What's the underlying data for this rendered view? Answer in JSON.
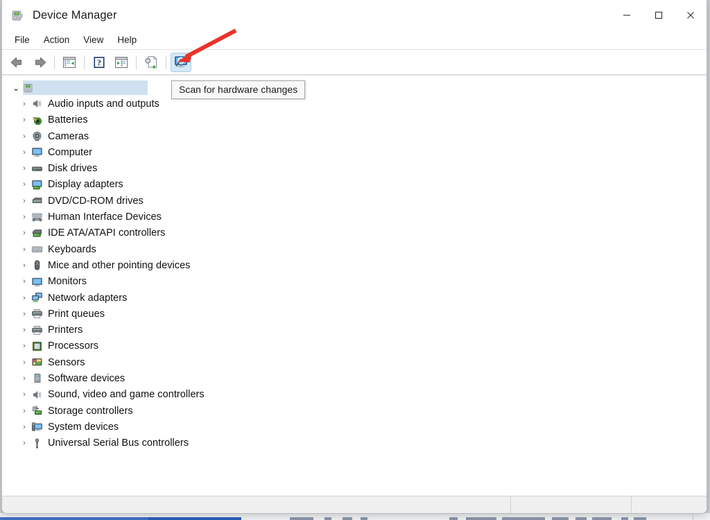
{
  "window": {
    "title": "Device Manager",
    "app_icon": "device-manager-icon",
    "caption": {
      "minimize_label": "Minimize",
      "minimize_icon": "minimize-icon",
      "maximize_label": "Maximize",
      "maximize_icon": "maximize-icon",
      "close_label": "Close",
      "close_icon": "close-icon"
    }
  },
  "menubar": {
    "items": [
      {
        "label": "File"
      },
      {
        "label": "Action"
      },
      {
        "label": "View"
      },
      {
        "label": "Help"
      }
    ]
  },
  "toolbar": {
    "buttons": [
      {
        "name": "back-button",
        "icon": "back-arrow-icon",
        "label": "Back"
      },
      {
        "name": "forward-button",
        "icon": "forward-arrow-icon",
        "label": "Forward"
      },
      {
        "name": "show-hide-console-tree-button",
        "icon": "console-tree-icon",
        "label": "Show/Hide Console Tree"
      },
      {
        "name": "help-button",
        "icon": "help-question-icon",
        "label": "Help"
      },
      {
        "name": "properties-button",
        "icon": "properties-icon",
        "label": "Properties"
      },
      {
        "name": "update-driver-button",
        "icon": "update-driver-icon",
        "label": "Update Driver"
      },
      {
        "name": "scan-for-hardware-changes-button",
        "icon": "scan-hardware-icon",
        "label": "Scan for hardware changes"
      }
    ],
    "active_button": "scan-for-hardware-changes-button"
  },
  "tooltip": {
    "text": "Scan for hardware changes",
    "visible": true
  },
  "annotation": {
    "arrow": "red-arrow-pointing-to-scan-button",
    "color": "#e8342a"
  },
  "tree": {
    "root": {
      "label": "",
      "label_redacted": true,
      "icon": "computer-node-icon",
      "expanded": true,
      "selected": true
    },
    "items": [
      {
        "label": "Audio inputs and outputs",
        "icon": "speaker-icon",
        "expanded": false
      },
      {
        "label": "Batteries",
        "icon": "battery-icon",
        "expanded": false
      },
      {
        "label": "Cameras",
        "icon": "camera-icon",
        "expanded": false
      },
      {
        "label": "Computer",
        "icon": "monitor-icon",
        "expanded": false
      },
      {
        "label": "Disk drives",
        "icon": "disk-drive-icon",
        "expanded": false
      },
      {
        "label": "Display adapters",
        "icon": "display-adapter-icon",
        "expanded": false
      },
      {
        "label": "DVD/CD-ROM drives",
        "icon": "optical-drive-icon",
        "expanded": false
      },
      {
        "label": "Human Interface Devices",
        "icon": "gamepad-icon",
        "expanded": false
      },
      {
        "label": "IDE ATA/ATAPI controllers",
        "icon": "ide-controller-icon",
        "expanded": false
      },
      {
        "label": "Keyboards",
        "icon": "keyboard-icon",
        "expanded": false
      },
      {
        "label": "Mice and other pointing devices",
        "icon": "mouse-icon",
        "expanded": false
      },
      {
        "label": "Monitors",
        "icon": "monitor-icon",
        "expanded": false
      },
      {
        "label": "Network adapters",
        "icon": "network-adapter-icon",
        "expanded": false
      },
      {
        "label": "Print queues",
        "icon": "printer-icon",
        "expanded": false
      },
      {
        "label": "Printers",
        "icon": "printer-icon",
        "expanded": false
      },
      {
        "label": "Processors",
        "icon": "processor-chip-icon",
        "expanded": false
      },
      {
        "label": "Sensors",
        "icon": "sensor-icon",
        "expanded": false
      },
      {
        "label": "Software devices",
        "icon": "software-device-icon",
        "expanded": false
      },
      {
        "label": "Sound, video and game controllers",
        "icon": "speaker-icon",
        "expanded": false
      },
      {
        "label": "Storage controllers",
        "icon": "storage-controller-icon",
        "expanded": false
      },
      {
        "label": "System devices",
        "icon": "system-device-icon",
        "expanded": false
      },
      {
        "label": "Universal Serial Bus controllers",
        "icon": "usb-icon",
        "expanded": false
      }
    ],
    "chevron_glyph": "›",
    "expanded_glyph": "⌄"
  },
  "statusbar": {
    "pane1": "",
    "pane2": "",
    "pane3": ""
  },
  "colors": {
    "accent": "#2a5cb8",
    "annotation_red": "#e8342a",
    "selection_blue": "#cfe1f0",
    "toolbar_active": "#d5e8f7"
  }
}
